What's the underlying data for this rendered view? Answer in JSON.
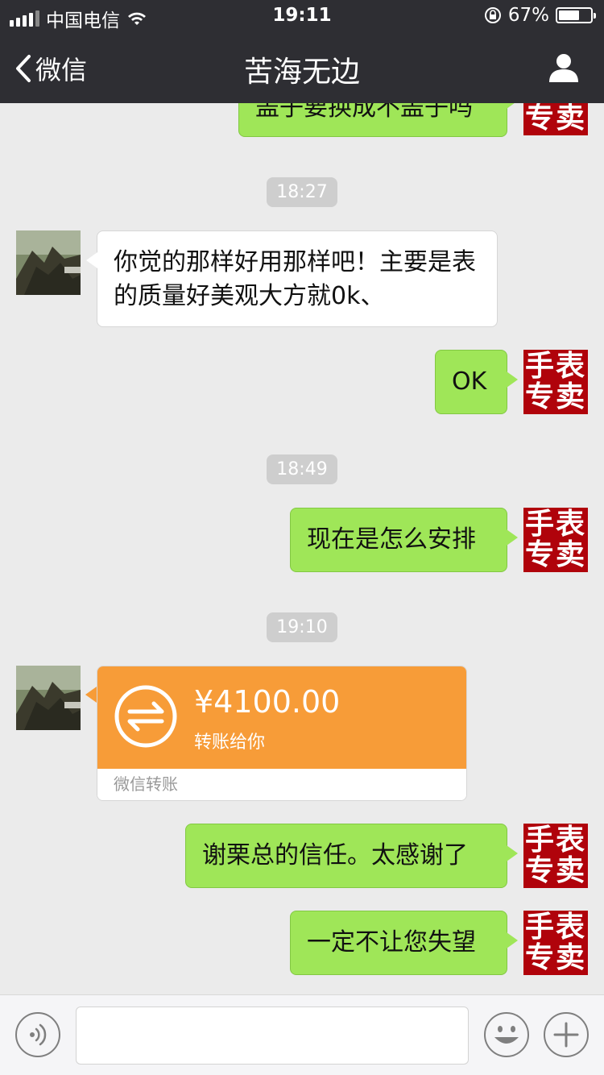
{
  "status_bar": {
    "carrier": "中国电信",
    "time": "19:11",
    "battery_percent": "67%",
    "battery_level": 0.67
  },
  "nav": {
    "back_label": "微信",
    "title": "苦海无边"
  },
  "right_avatar_text": "手表专卖",
  "messages": {
    "m0": {
      "text": "盖子要换成不盖子吗"
    },
    "t1": {
      "time": "18:27"
    },
    "m1": {
      "text": "你觉的那样好用那样吧！主要是表的质量好美观大方就0k、"
    },
    "m2": {
      "text": "OK"
    },
    "t2": {
      "time": "18:49"
    },
    "m3": {
      "text": "现在是怎么安排"
    },
    "t3": {
      "time": "19:10"
    },
    "transfer": {
      "amount": "¥4100.00",
      "note": "转账给你",
      "footer": "微信转账"
    },
    "m4": {
      "text": "谢栗总的信任。太感谢了"
    },
    "m5": {
      "text": "一定不让您失望"
    }
  },
  "icons": {
    "back": "chevron-left-icon",
    "profile": "person-icon",
    "voice": "voice-icon",
    "emoji": "smile-icon",
    "plus": "plus-icon",
    "transfer": "transfer-arrows-icon"
  },
  "colors": {
    "header_bg": "#2e2e33",
    "chat_bg": "#ebebeb",
    "green_bubble": "#9fe658",
    "transfer_orange": "#f79c38",
    "avatar_red": "#b0030b"
  }
}
